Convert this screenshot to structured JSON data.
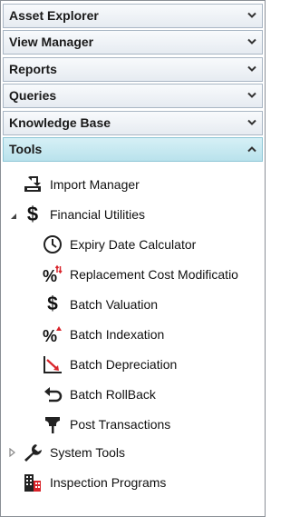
{
  "accordion": [
    {
      "label": "Asset Explorer",
      "state": "collapsed"
    },
    {
      "label": "View Manager",
      "state": "collapsed"
    },
    {
      "label": "Reports",
      "state": "collapsed"
    },
    {
      "label": "Queries",
      "state": "collapsed"
    },
    {
      "label": "Knowledge Base",
      "state": "collapsed"
    },
    {
      "label": "Tools",
      "state": "expanded"
    }
  ],
  "tools_tree": {
    "import_manager": "Import Manager",
    "financial_utilities": {
      "label": "Financial Utilities",
      "expanded": true,
      "children": {
        "expiry_date_calculator": "Expiry Date Calculator",
        "replacement_cost": "Replacement Cost Modificatio",
        "batch_valuation": "Batch Valuation",
        "batch_indexation": "Batch Indexation",
        "batch_depreciation": "Batch Depreciation",
        "batch_rollback": "Batch RollBack",
        "post_transactions": "Post Transactions"
      }
    },
    "system_tools": {
      "label": "System Tools",
      "expanded": false
    },
    "inspection_programs": "Inspection Programs"
  },
  "colors": {
    "header_active": "#c6e8f0",
    "header_inactive": "#eef1f5",
    "accent_red": "#d9242b"
  }
}
